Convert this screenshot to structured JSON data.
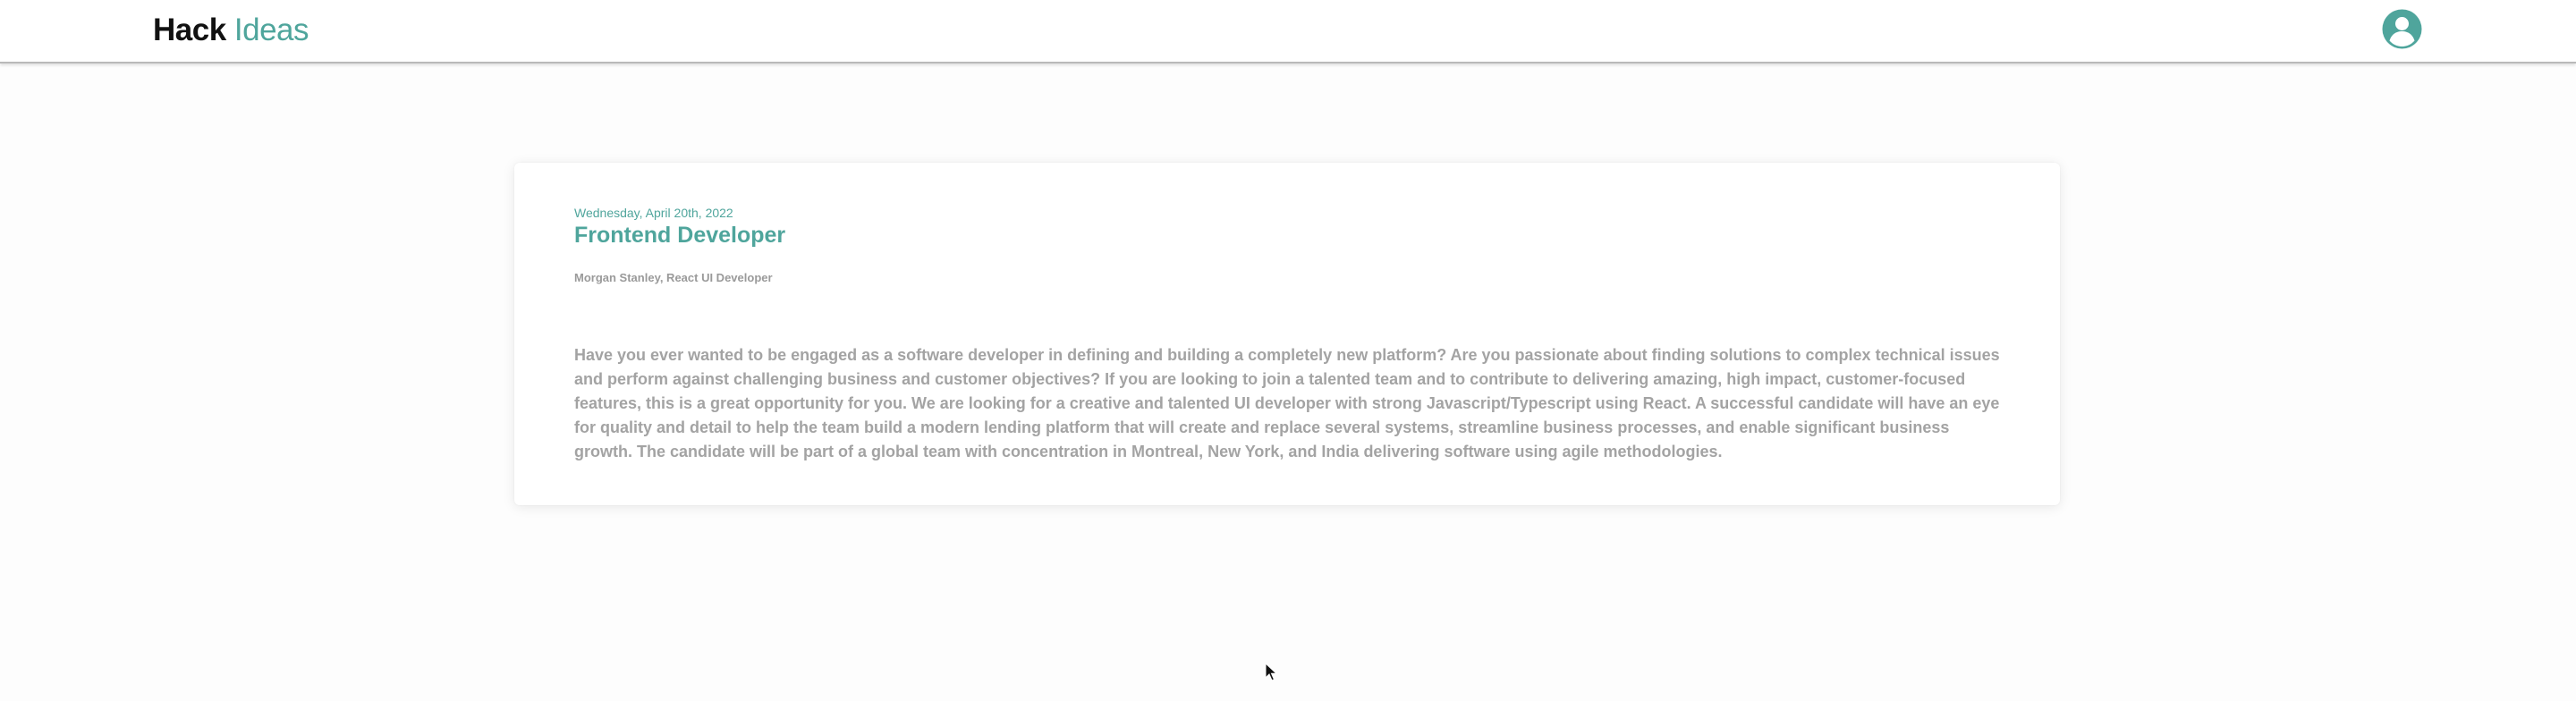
{
  "header": {
    "brand_primary": "Hack",
    "brand_secondary": "Ideas",
    "avatar_icon": "user-avatar-icon",
    "accent_color": "#4fa59c"
  },
  "post": {
    "date": "Wednesday, April 20th, 2022",
    "title": "Frontend Developer",
    "company": "Morgan Stanley, React UI Developer",
    "description": "Have you ever wanted to be engaged as a software developer in defining and building a completely new platform? Are you passionate about finding solutions to complex technical issues and perform against challenging business and customer objectives? If you are looking to join a talented team and to contribute to delivering amazing, high impact, customer-focused features, this is a great opportunity for you. We are looking for a creative and talented UI developer with strong Javascript/Typescript using React. A successful candidate will have an eye for quality and detail to help the team build a modern lending platform that will create and replace several systems, streamline business processes, and enable significant business growth. The candidate will be part of a global team with concentration in Montreal, New York, and India delivering software using agile methodologies."
  }
}
